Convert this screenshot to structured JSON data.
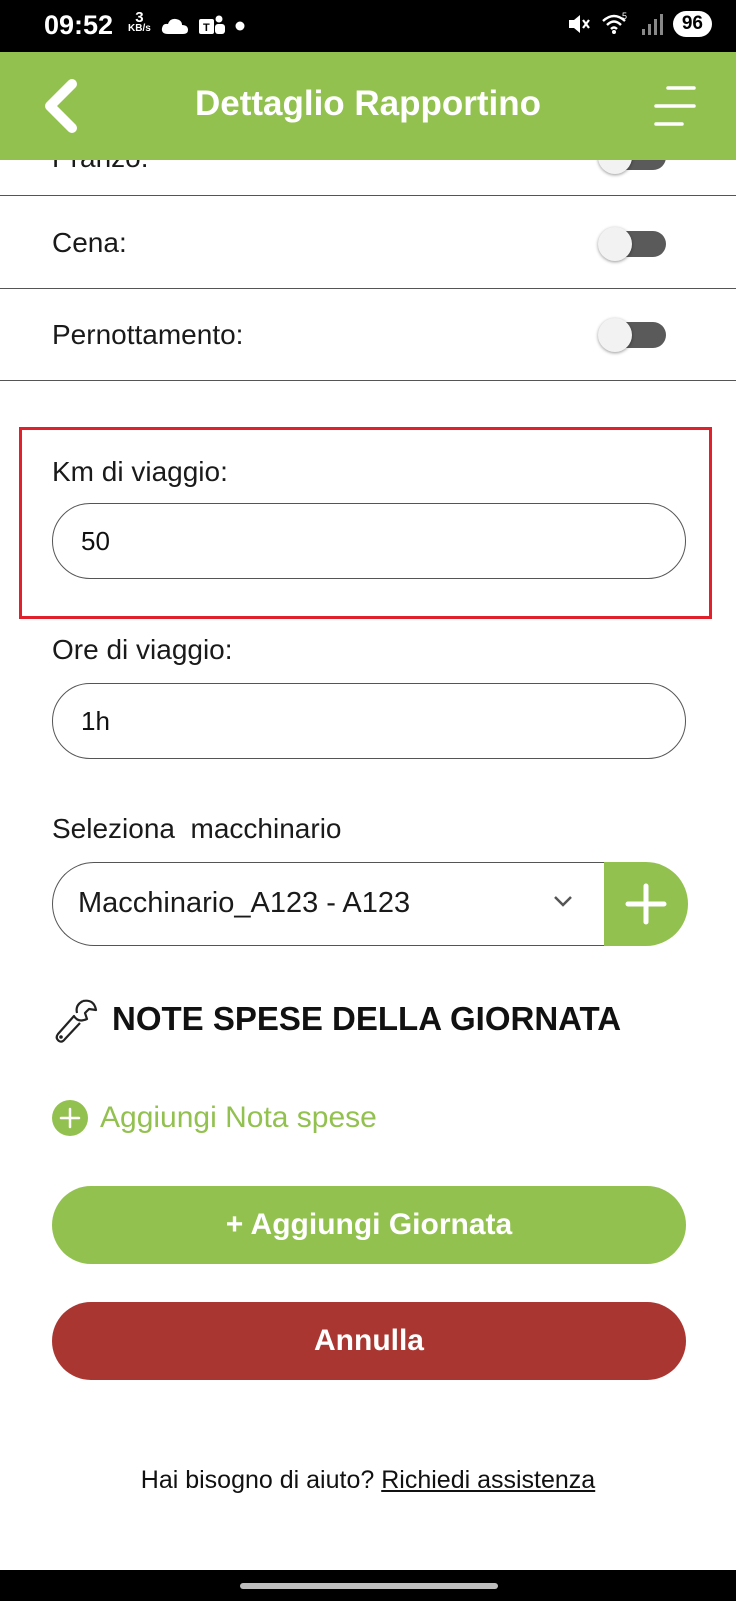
{
  "status_bar": {
    "time": "09:52",
    "speed_value": "3",
    "speed_unit": "KB/s",
    "battery": "96",
    "icons": [
      "cloud-icon",
      "teams-icon",
      "dot-icon",
      "mute-icon",
      "wifi-icon",
      "signal-icon",
      "battery-icon"
    ]
  },
  "header": {
    "title": "Dettaglio Rapportino",
    "back_icon": "chevron-left-icon",
    "menu_icon": "hamburger-icon"
  },
  "toggles": [
    {
      "label": "Pranzo:",
      "on": false
    },
    {
      "label": "Cena:",
      "on": false
    },
    {
      "label": "Pernottamento:",
      "on": false
    }
  ],
  "km": {
    "label": "Km di viaggio:",
    "value": "50"
  },
  "ore": {
    "label": "Ore di viaggio:",
    "value": "1h"
  },
  "machinery": {
    "label": "Seleziona  macchinario",
    "selected": "Macchinario_A123 - A123",
    "add_icon": "plus-icon"
  },
  "expenses": {
    "title": "NOTE SPESE DELLA GIORNATA",
    "icon": "wrench-icon",
    "add_label": "Aggiungi Nota spese"
  },
  "actions": {
    "add_day": "+ Aggiungi Giornata",
    "cancel": "Annulla"
  },
  "help": {
    "text": "Hai bisogno di aiuto? ",
    "link": "Richiedi assistenza"
  },
  "colors": {
    "accent_green": "#93c150",
    "cancel_red": "#a93631",
    "highlight_red": "#e0202a"
  }
}
